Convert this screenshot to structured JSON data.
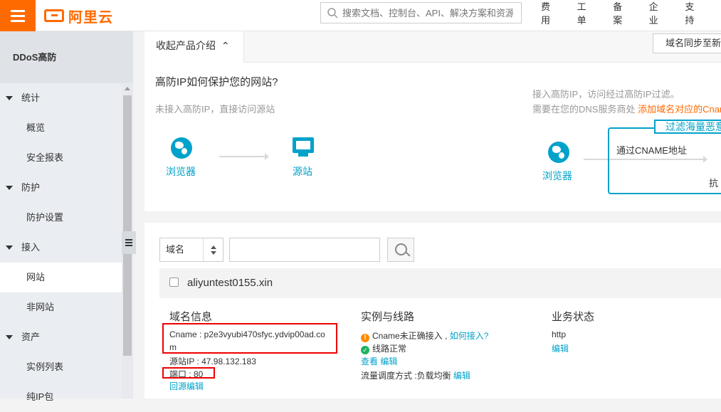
{
  "topbar": {
    "logo_text": "阿里云",
    "search_placeholder": "搜索文档、控制台、API、解决方案和资源",
    "nav": [
      "费用",
      "工单",
      "备案",
      "企业",
      "支持"
    ]
  },
  "sidebar": {
    "title": "DDoS高防",
    "groups": [
      {
        "label": "统计",
        "items": [
          "概览",
          "安全报表"
        ]
      },
      {
        "label": "防护",
        "items": [
          "防护设置"
        ]
      },
      {
        "label": "接入",
        "items": [
          "网站",
          "非网站"
        ]
      },
      {
        "label": "资产",
        "items": [
          "实例列表",
          "纯IP包"
        ]
      }
    ],
    "active_item": "网站"
  },
  "intro": {
    "tab_label": "收起产品介绍",
    "sync_button": "域名同步至新版",
    "title": "高防IP如何保护您的网站?",
    "without_caption": "未接入高防IP，直接访问源站",
    "with_caption_1": "接入高防IP，访问经过高防IP过滤。",
    "with_caption_2": "需要在您的DNS服务商处",
    "with_caption_link": "添加域名对应的Cname",
    "browser_label": "浏览器",
    "origin_label": "源站",
    "filter_tag": "过滤海量恶意",
    "cname_label": "通过CNAME地址",
    "anti_label": "抗"
  },
  "toolbar": {
    "select_value": "域名",
    "search_value": ""
  },
  "record": {
    "domain": "aliyuntest0155.xin",
    "domain_info_title": "域名信息",
    "cname_line_1": "Cname : p2e3vyubi470sfyc.ydvip00ad.co",
    "cname_line_2": "m",
    "origin_ip": "源站IP : 47.98.132.183",
    "port": "端口 : 80",
    "origin_edit": "回源编辑",
    "instance_title": "实例与线路",
    "cname_status": "Cname未正确接入 ,",
    "how_to_link": "如何接入?",
    "line_status": "线路正常",
    "view_link": "查看",
    "edit_link": "编辑",
    "schedule": "流量调度方式 :负载均衡",
    "schedule_edit": "编辑",
    "status_title": "业务状态",
    "protocol": "http",
    "protocol_edit": "编辑"
  }
}
